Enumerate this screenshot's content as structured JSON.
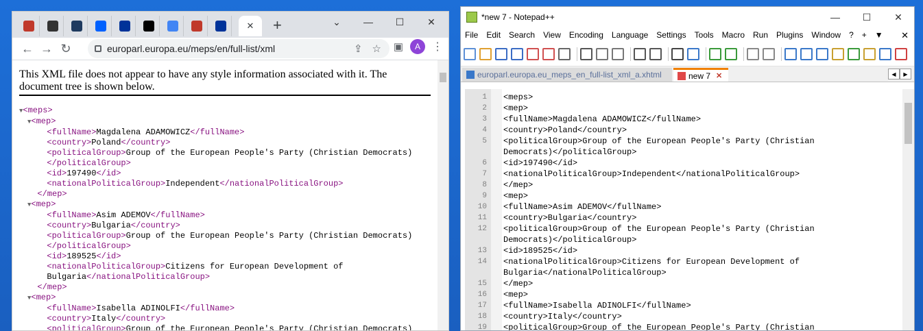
{
  "chrome": {
    "tabs": [
      {
        "icon": "pdf-icon",
        "color": "#c0392b"
      },
      {
        "icon": "latex-icon",
        "color": "#333333"
      },
      {
        "icon": "app-icon",
        "color": "#1e3a5f"
      },
      {
        "icon": "dropbox-icon",
        "color": "#0061fe"
      },
      {
        "icon": "eu-flag-icon",
        "color": "#003399"
      },
      {
        "icon": "wikipedia-icon",
        "color": "#000000"
      },
      {
        "icon": "google-icon",
        "color": "#4285f4"
      },
      {
        "icon": "pdf-icon",
        "color": "#c0392b"
      },
      {
        "icon": "eu-flag-icon",
        "color": "#003399"
      }
    ],
    "url": "europarl.europa.eu/meps/en/full-list/xml",
    "avatar": "A",
    "note": "This XML file does not appear to have any style information associated with it. The document tree is shown below.",
    "tree": [
      {
        "indent": 0,
        "arrow": "▼",
        "parts": [
          {
            "t": "<meps>",
            "tag": true
          }
        ]
      },
      {
        "indent": 1,
        "arrow": "▼",
        "parts": [
          {
            "t": "<mep>",
            "tag": true
          }
        ]
      },
      {
        "indent": 2,
        "arrow": "",
        "parts": [
          {
            "t": "<fullName>",
            "tag": true
          },
          {
            "t": "Magdalena ADAMOWICZ"
          },
          {
            "t": "</fullName>",
            "tag": true
          }
        ]
      },
      {
        "indent": 2,
        "arrow": "",
        "parts": [
          {
            "t": "<country>",
            "tag": true
          },
          {
            "t": "Poland"
          },
          {
            "t": "</country>",
            "tag": true
          }
        ]
      },
      {
        "indent": 2,
        "arrow": "",
        "parts": [
          {
            "t": "<politicalGroup>",
            "tag": true
          },
          {
            "t": "Group of the European People's Party (Christian Democrats)"
          }
        ]
      },
      {
        "indent": 2,
        "arrow": "",
        "parts": [
          {
            "t": "</politicalGroup>",
            "tag": true
          }
        ]
      },
      {
        "indent": 2,
        "arrow": "",
        "parts": [
          {
            "t": "<id>",
            "tag": true
          },
          {
            "t": "197490"
          },
          {
            "t": "</id>",
            "tag": true
          }
        ]
      },
      {
        "indent": 2,
        "arrow": "",
        "parts": [
          {
            "t": "<nationalPoliticalGroup>",
            "tag": true
          },
          {
            "t": "Independent"
          },
          {
            "t": "</nationalPoliticalGroup>",
            "tag": true
          }
        ]
      },
      {
        "indent": 1,
        "arrow": "",
        "parts": [
          {
            "t": "</mep>",
            "tag": true
          }
        ]
      },
      {
        "indent": 1,
        "arrow": "▼",
        "parts": [
          {
            "t": "<mep>",
            "tag": true
          }
        ]
      },
      {
        "indent": 2,
        "arrow": "",
        "parts": [
          {
            "t": "<fullName>",
            "tag": true
          },
          {
            "t": "Asim ADEMOV"
          },
          {
            "t": "</fullName>",
            "tag": true
          }
        ]
      },
      {
        "indent": 2,
        "arrow": "",
        "parts": [
          {
            "t": "<country>",
            "tag": true
          },
          {
            "t": "Bulgaria"
          },
          {
            "t": "</country>",
            "tag": true
          }
        ]
      },
      {
        "indent": 2,
        "arrow": "",
        "parts": [
          {
            "t": "<politicalGroup>",
            "tag": true
          },
          {
            "t": "Group of the European People's Party (Christian Democrats)"
          }
        ]
      },
      {
        "indent": 2,
        "arrow": "",
        "parts": [
          {
            "t": "</politicalGroup>",
            "tag": true
          }
        ]
      },
      {
        "indent": 2,
        "arrow": "",
        "parts": [
          {
            "t": "<id>",
            "tag": true
          },
          {
            "t": "189525"
          },
          {
            "t": "</id>",
            "tag": true
          }
        ]
      },
      {
        "indent": 2,
        "arrow": "",
        "parts": [
          {
            "t": "<nationalPoliticalGroup>",
            "tag": true
          },
          {
            "t": "Citizens for European Development of"
          }
        ]
      },
      {
        "indent": 2,
        "arrow": "",
        "parts": [
          {
            "t": "Bulgaria"
          },
          {
            "t": "</nationalPoliticalGroup>",
            "tag": true
          }
        ]
      },
      {
        "indent": 1,
        "arrow": "",
        "parts": [
          {
            "t": "</mep>",
            "tag": true
          }
        ]
      },
      {
        "indent": 1,
        "arrow": "▼",
        "parts": [
          {
            "t": "<mep>",
            "tag": true
          }
        ]
      },
      {
        "indent": 2,
        "arrow": "",
        "parts": [
          {
            "t": "<fullName>",
            "tag": true
          },
          {
            "t": "Isabella ADINOLFI"
          },
          {
            "t": "</fullName>",
            "tag": true
          }
        ]
      },
      {
        "indent": 2,
        "arrow": "",
        "parts": [
          {
            "t": "<country>",
            "tag": true
          },
          {
            "t": "Italy"
          },
          {
            "t": "</country>",
            "tag": true
          }
        ]
      },
      {
        "indent": 2,
        "arrow": "",
        "parts": [
          {
            "t": "<politicalGroup>",
            "tag": true
          },
          {
            "t": "Group of the European People's Party (Christian Democrats)"
          }
        ]
      }
    ]
  },
  "npp": {
    "title": "*new 7 - Notepad++",
    "menu": [
      "File",
      "Edit",
      "Search",
      "View",
      "Encoding",
      "Language",
      "Settings",
      "Tools",
      "Macro",
      "Run",
      "Plugins",
      "Window",
      "?",
      "+",
      "▼"
    ],
    "tab_inactive": "europarl.europa.eu_meps_en_full-list_xml_a.xhtml",
    "tab_active": "new 7",
    "lines": [
      {
        "n": "1",
        "t": "<meps>"
      },
      {
        "n": "2",
        "t": "<mep>"
      },
      {
        "n": "3",
        "t": "<fullName>Magdalena ADAMOWICZ</fullName>"
      },
      {
        "n": "4",
        "t": "<country>Poland</country>"
      },
      {
        "n": "5",
        "t": "<politicalGroup>Group of the European People's Party (Christian"
      },
      {
        "n": "",
        "t": "Democrats)</politicalGroup>"
      },
      {
        "n": "6",
        "t": "<id>197490</id>"
      },
      {
        "n": "7",
        "t": "<nationalPoliticalGroup>Independent</nationalPoliticalGroup>"
      },
      {
        "n": "8",
        "t": "</mep>"
      },
      {
        "n": "9",
        "t": "<mep>"
      },
      {
        "n": "10",
        "t": "<fullName>Asim ADEMOV</fullName>"
      },
      {
        "n": "11",
        "t": "<country>Bulgaria</country>"
      },
      {
        "n": "12",
        "t": "<politicalGroup>Group of the European People's Party (Christian"
      },
      {
        "n": "",
        "t": "Democrats)</politicalGroup>"
      },
      {
        "n": "13",
        "t": "<id>189525</id>"
      },
      {
        "n": "14",
        "t": "<nationalPoliticalGroup>Citizens for European Development of"
      },
      {
        "n": "",
        "t": "Bulgaria</nationalPoliticalGroup>"
      },
      {
        "n": "15",
        "t": "</mep>"
      },
      {
        "n": "16",
        "t": "<mep>"
      },
      {
        "n": "17",
        "t": "<fullName>Isabella ADINOLFI</fullName>"
      },
      {
        "n": "18",
        "t": "<country>Italy</country>"
      },
      {
        "n": "19",
        "t": "<politicalGroup>Group of the European People's Party (Christian"
      }
    ]
  }
}
